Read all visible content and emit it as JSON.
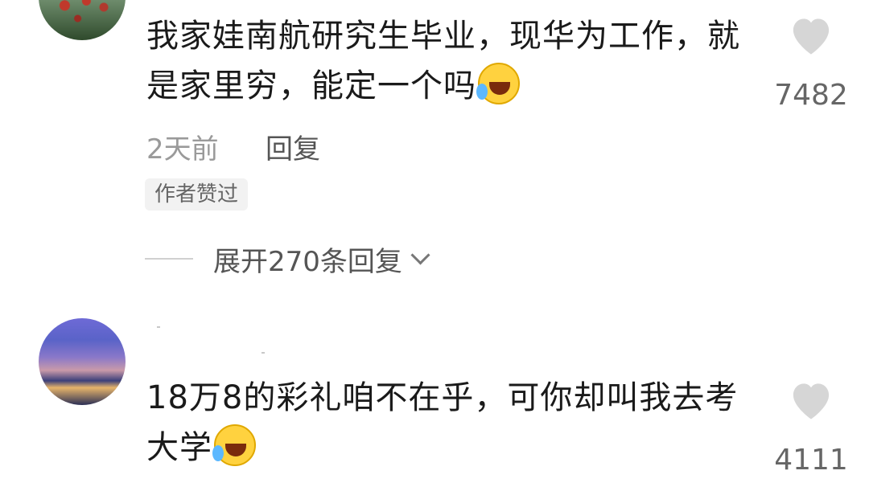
{
  "comments": [
    {
      "text": "我家娃南航研究生毕业，现华为工作，就是家里穷，能定一个吗",
      "emoji": "grinning-squinting-tears-emoji",
      "time": "2天前",
      "reply_label": "回复",
      "author_liked_badge": "作者赞过",
      "expand_label": "展开270条回复",
      "like_count": "7482"
    },
    {
      "text": "18万8的彩礼咱不在乎，可你却叫我去考大学",
      "emoji": "grinning-squinting-tears-emoji",
      "like_count": "4111"
    }
  ],
  "colors": {
    "text": "#1a1a1a",
    "muted": "#9a9a9a",
    "heart": "#d6d6d6"
  },
  "icons": {
    "like": "heart-icon",
    "expand": "chevron-down-icon"
  }
}
